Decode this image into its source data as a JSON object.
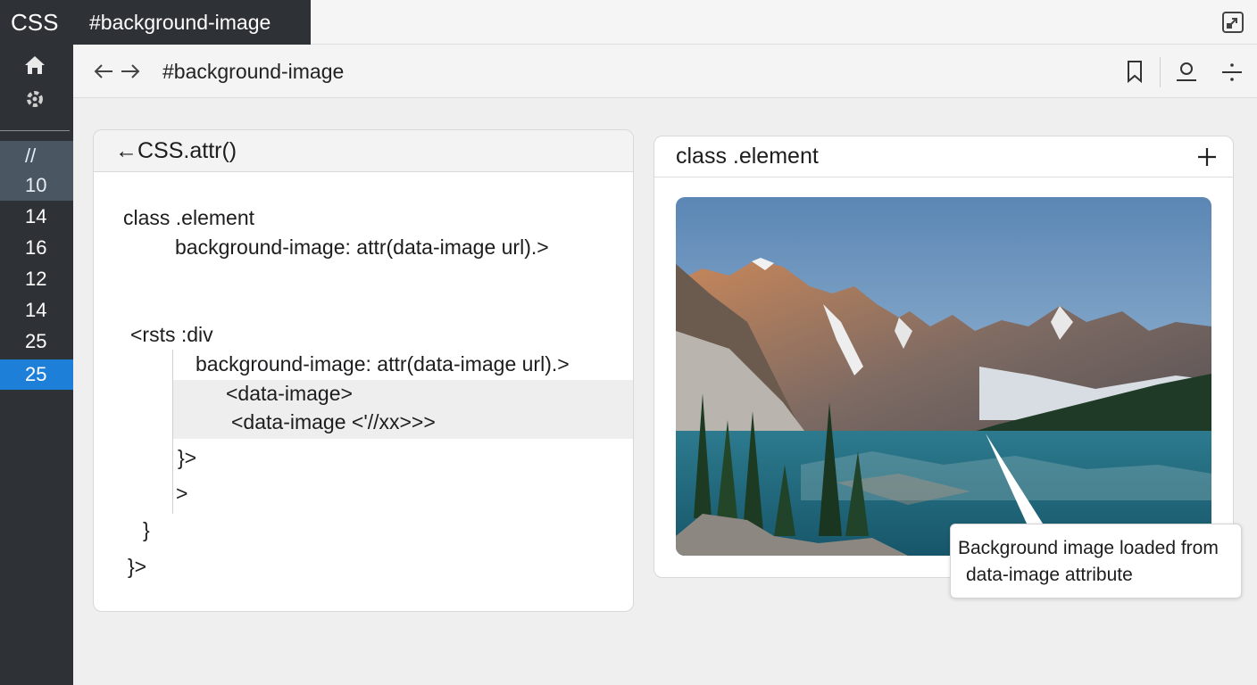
{
  "app": {
    "logo": "CSS"
  },
  "tabs": [
    {
      "label": "#background-image",
      "active": true
    }
  ],
  "toolbar": {
    "address": "#background-image"
  },
  "sidebar": {
    "line_numbers": [
      {
        "label": "//",
        "state": "muted"
      },
      {
        "label": "10",
        "state": "muted"
      },
      {
        "label": "14",
        "state": "normal"
      },
      {
        "label": "16",
        "state": "normal"
      },
      {
        "label": "12",
        "state": "normal"
      },
      {
        "label": "14",
        "state": "normal"
      },
      {
        "label": "25",
        "state": "normal"
      },
      {
        "label": "25",
        "state": "active"
      }
    ]
  },
  "code_panel": {
    "title": "←CSS.attr()",
    "lines": [
      "class .element",
      "background-image: attr(data-image url).>",
      "<rsts :div",
      "background-image: attr(data-image url).>",
      "<data-image>",
      "<data-image <'//xx>>>",
      "}>",
      ">",
      "}",
      "}>"
    ]
  },
  "preview_panel": {
    "title": "class .element",
    "image_description_icon": "mountain-lake-photo"
  },
  "callout": {
    "line1": "Background image loaded from",
    "line2": "data-image attribute"
  },
  "colors": {
    "sidebar_bg": "#2e3135",
    "active_line": "#1e7fd8",
    "muted_line": "#4b5663",
    "page_bg": "#efefef"
  },
  "icons": [
    "home-icon",
    "settings-icon",
    "window-icon",
    "back-arrow-icon",
    "forward-arrow-icon",
    "bookmark-icon",
    "user-icon",
    "split-icon",
    "plus-icon"
  ]
}
